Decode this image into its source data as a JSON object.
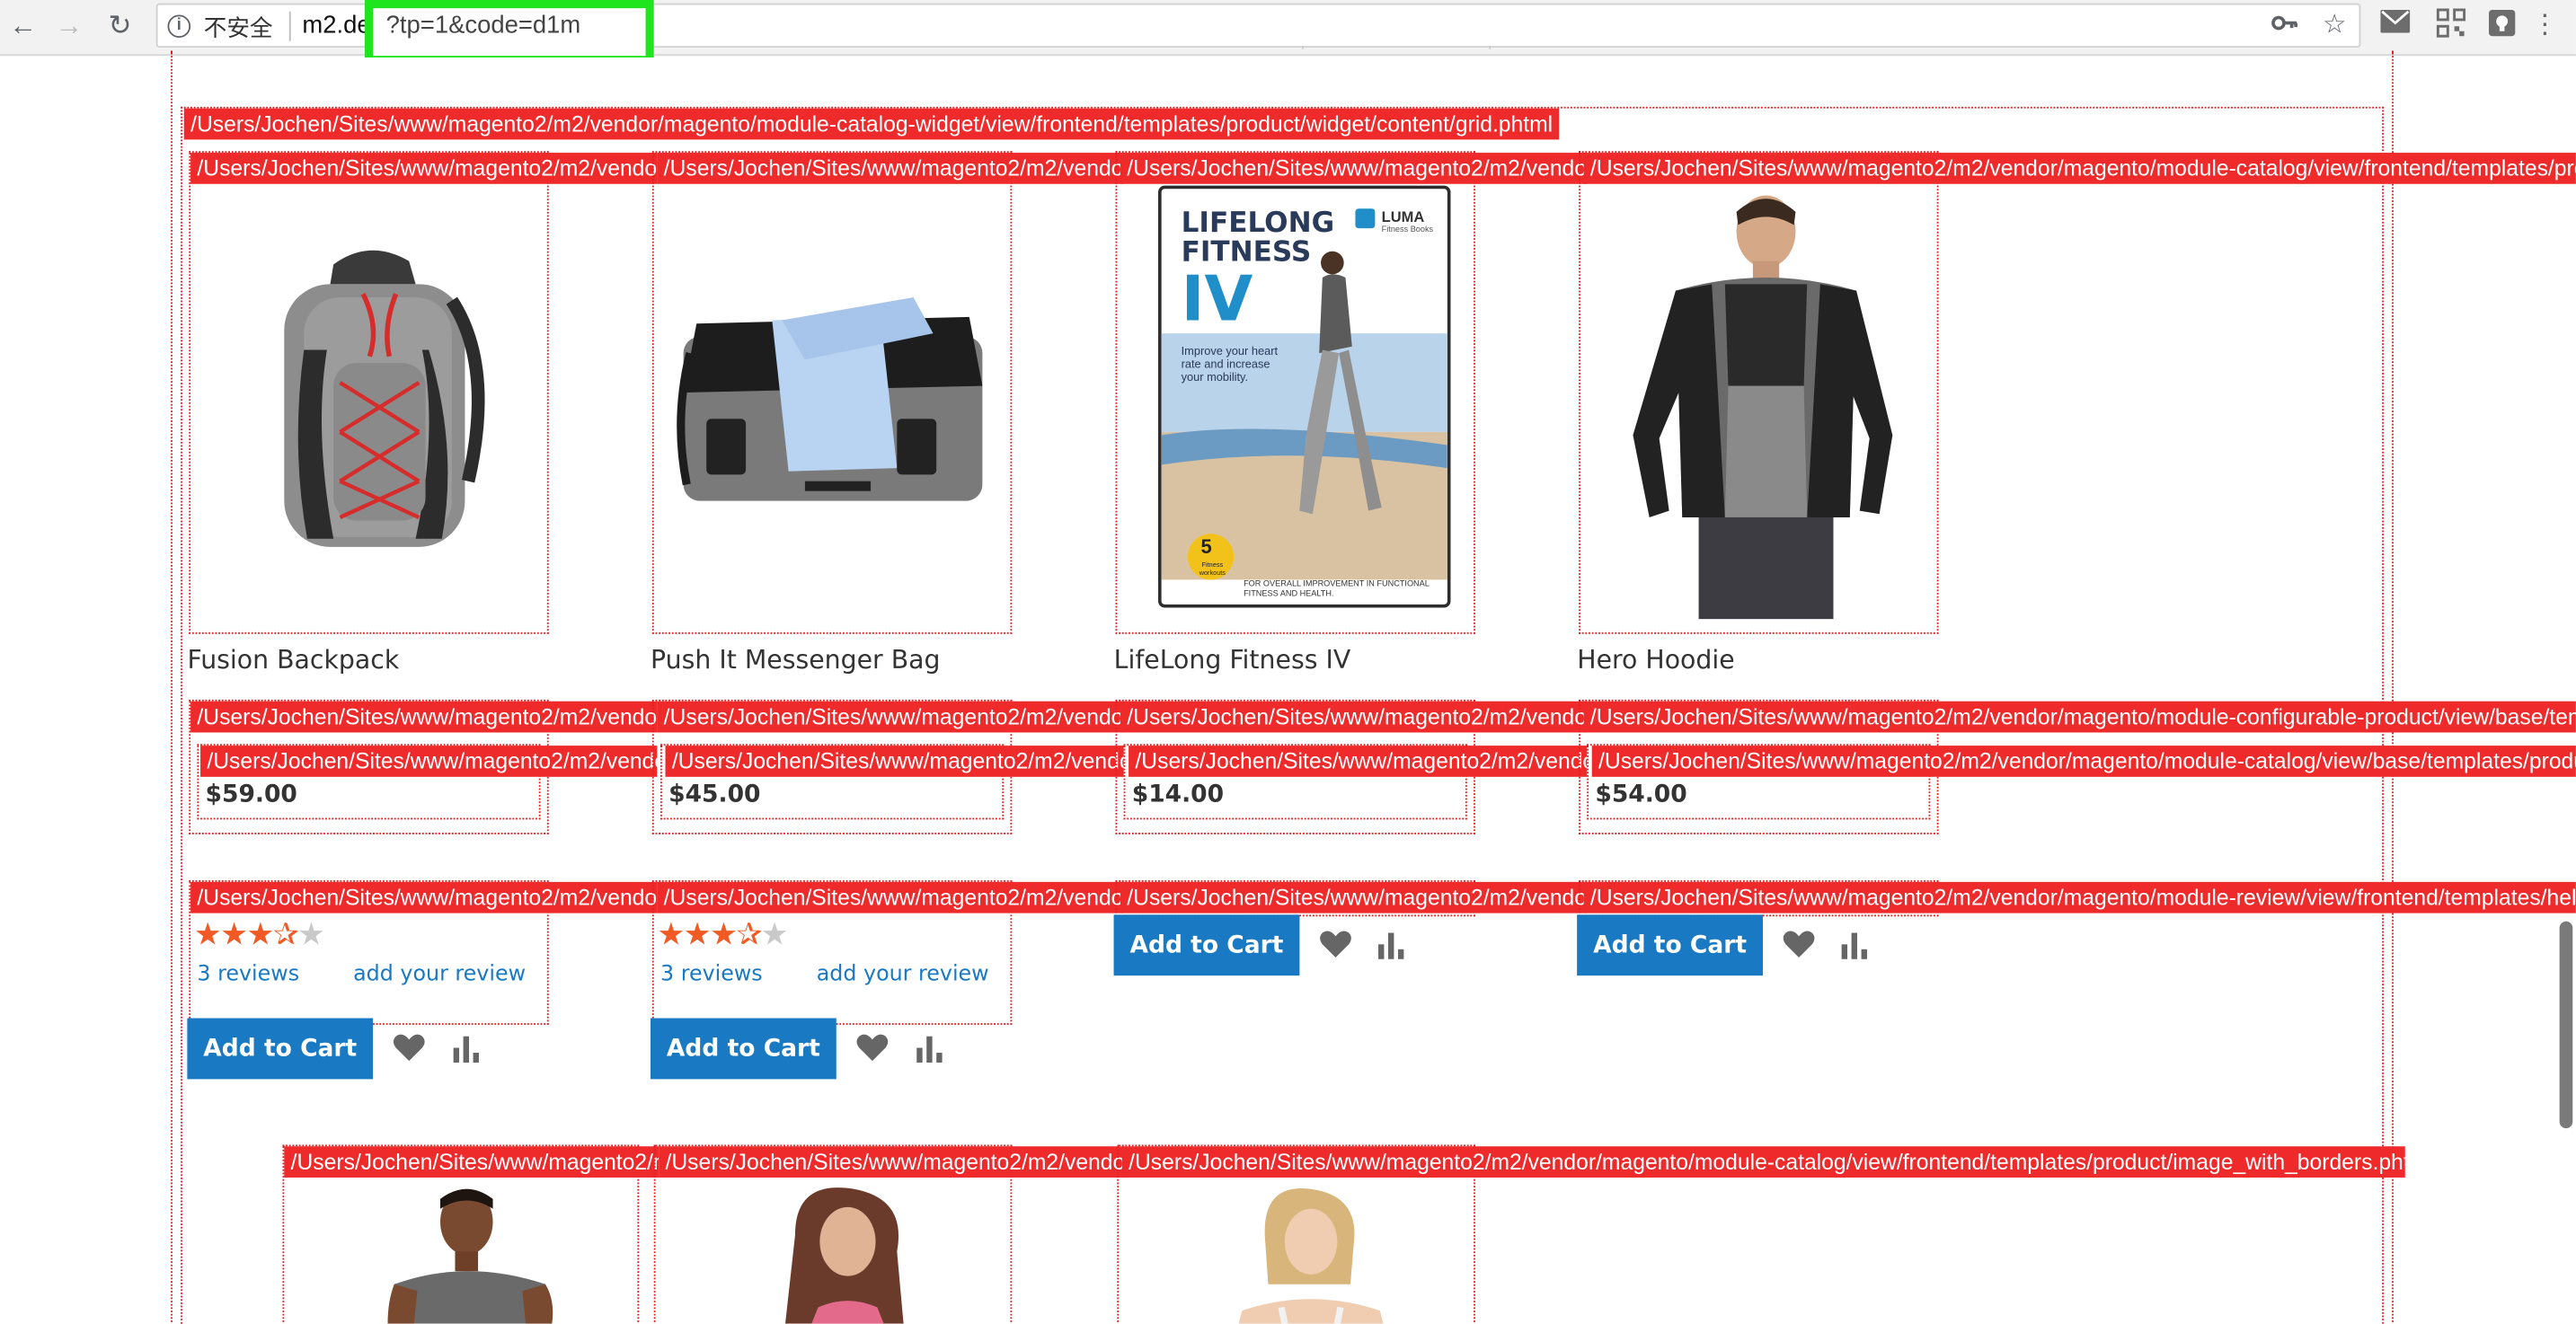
{
  "browser": {
    "security_label": "不安全",
    "host": "m2.de",
    "query": "?tp=1&code=d1m"
  },
  "widget_path": "/Users/Jochen/Sites/www/magento2/m2/vendor/magento/module-catalog-widget/view/frontend/templates/product/widget/content/grid.phtml",
  "paths": {
    "image_short": "/Users/Jochen/Sites/www/magento2/m2/vendor",
    "image_full": "/Users/Jochen/Sites/www/magento2/m2/vendor/magento/module-catalog/view/frontend/templates/product/image_with_borders.phtml",
    "configurable_full": "/Users/Jochen/Sites/www/magento2/m2/vendor/magento/module-configurable-product/view/base/templates/product/price/final_price.phtml",
    "price_full": "/Users/Jochen/Sites/www/magento2/m2/vendor/magento/module-catalog/view/base/templates/product/price/amount/default.phtml",
    "review_full": "/Users/Jochen/Sites/www/magento2/m2/vendor/magento/module-review/view/frontend/templates/helper/summary_short.phtml",
    "row2_short": "/Users/Jochen/Sites/www/magento2/m"
  },
  "products": [
    {
      "name": "Fusion Backpack",
      "price": "$59.00",
      "rating_stars": 3.5,
      "reviews_label": "3  reviews",
      "add_review": "add your review",
      "cart_label": "Add to Cart"
    },
    {
      "name": "Push It Messenger Bag",
      "price": "$45.00",
      "rating_stars": 3.5,
      "reviews_label": "3  reviews",
      "add_review": "add your review",
      "cart_label": "Add to Cart"
    },
    {
      "name": "LifeLong Fitness IV",
      "price": "$14.00",
      "cart_label": "Add to Cart"
    },
    {
      "name": "Hero Hoodie",
      "price": "$54.00",
      "cart_label": "Add to Cart"
    }
  ],
  "dvd": {
    "title_line1": "LIFELONG",
    "title_line2": "FITNESS",
    "title_line3": "IV",
    "brand": "LUMA",
    "brand_sub": "Fitness Books",
    "tagline": "Improve your heart rate and increase your mobility.",
    "badge_number": "5",
    "badge_text": "Fitness workouts",
    "footer": "FOR OVERALL IMPROVEMENT IN FUNCTIONAL FITNESS AND HEALTH."
  },
  "colors": {
    "label_red": "#ef2a2a",
    "button_blue": "#1979c3",
    "star_orange": "#f15a24",
    "highlight_green": "#1ee51e"
  }
}
